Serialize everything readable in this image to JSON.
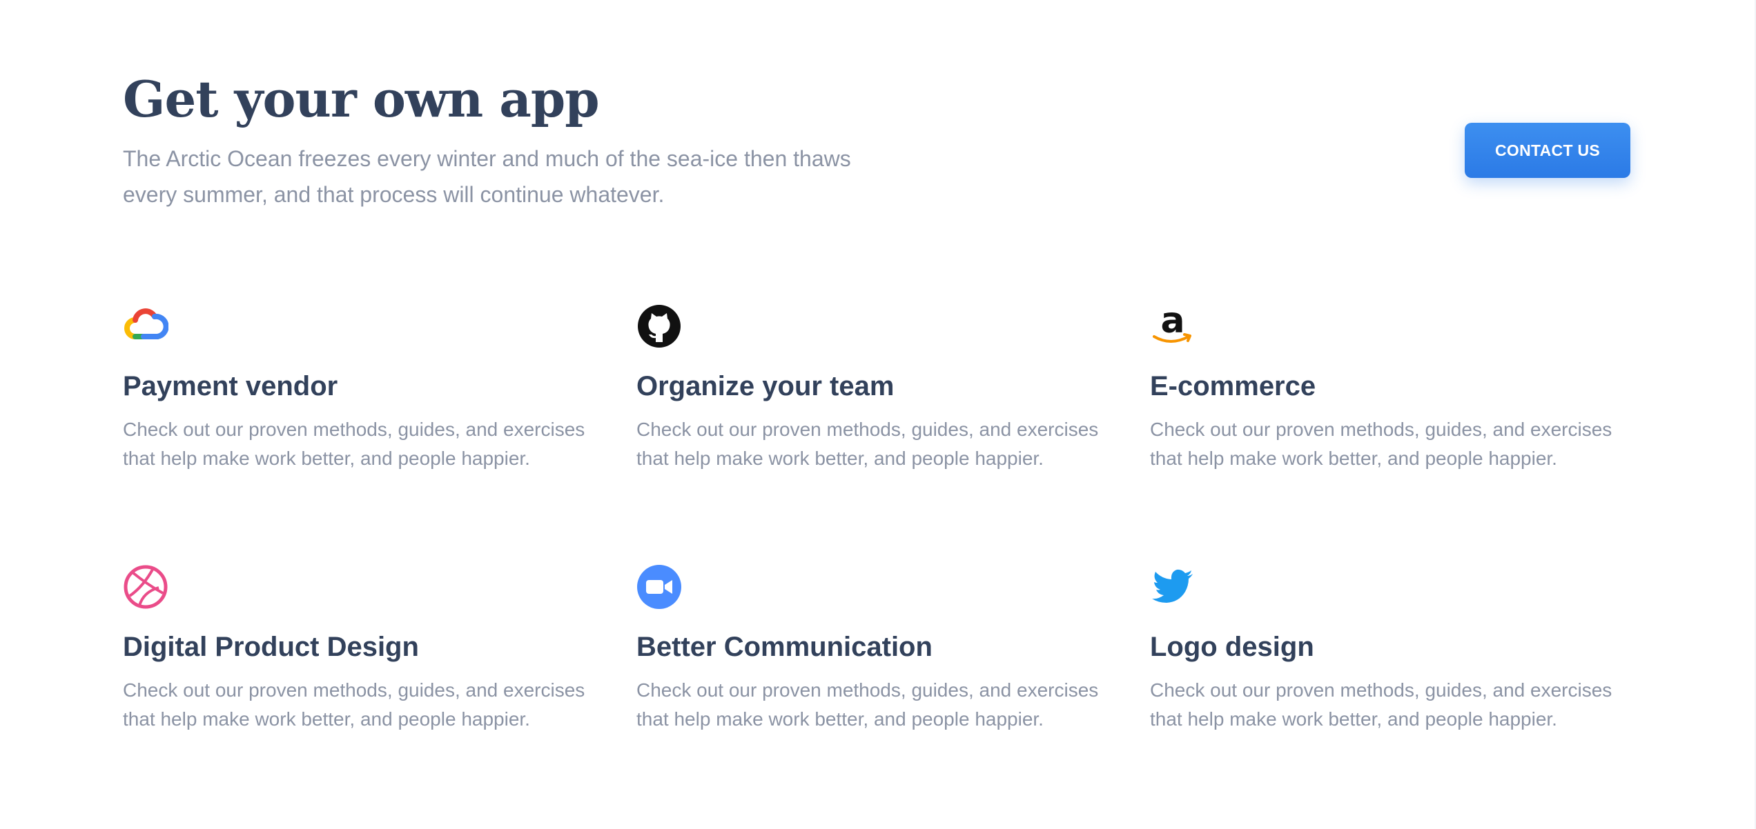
{
  "header": {
    "title": "Get your own app",
    "subtitle": "The Arctic Ocean freezes every winter and much of the sea-ice then thaws every summer, and that process will continue whatever.",
    "contact_label": "CONTACT US",
    "button_color": "#2b7ae6"
  },
  "features": [
    {
      "icon": "google-cloud-icon",
      "title": "Payment vendor",
      "description": "Check out our proven methods, guides, and exercises that help make work better, and people happier."
    },
    {
      "icon": "github-icon",
      "title": "Organize your team",
      "description": "Check out our proven methods, guides, and exercises that help make work better, and people happier."
    },
    {
      "icon": "amazon-icon",
      "title": "E-commerce",
      "description": "Check out our proven methods, guides, and exercises that help make work better, and people happier."
    },
    {
      "icon": "dribbble-icon",
      "title": "Digital Product Design",
      "description": "Check out our proven methods, guides, and exercises that help make work better, and people happier."
    },
    {
      "icon": "zoom-icon",
      "title": "Better Communication",
      "description": "Check out our proven methods, guides, and exercises that help make work better, and people happier."
    },
    {
      "icon": "twitter-icon",
      "title": "Logo design",
      "description": "Check out our proven methods, guides, and exercises that help make work better, and people happier."
    }
  ],
  "colors": {
    "heading": "#32415b",
    "body_text": "#8b93a4",
    "dribbble": "#ea4c89",
    "zoom": "#4a8cff",
    "twitter": "#1d9bf0",
    "amazon_smile": "#f79400"
  }
}
